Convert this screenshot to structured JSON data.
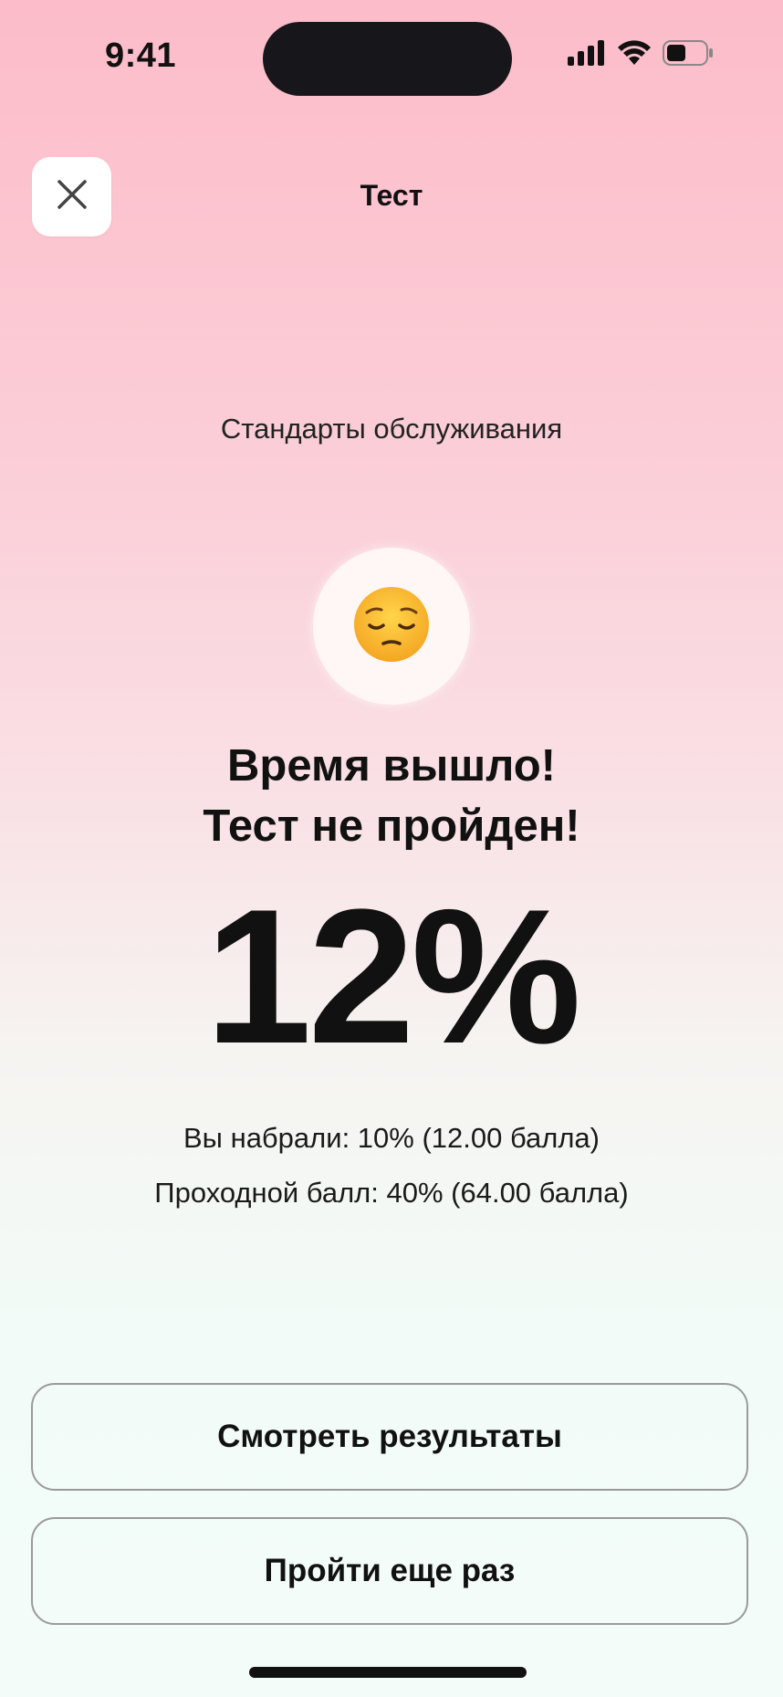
{
  "status_bar": {
    "time": "9:41",
    "icons": [
      "cellular-signal-icon",
      "wifi-icon",
      "battery-icon"
    ]
  },
  "header": {
    "title": "Тест",
    "close_icon": "close-icon"
  },
  "test": {
    "subject": "Стандарты обслуживания",
    "emoji": "😔",
    "result_line1": "Время вышло!",
    "result_line2": "Тест не пройден!",
    "percent_display": "12%",
    "score_text": "Вы набрали: 10% (12.00 балла)",
    "passing_text": "Проходной балл: 40% (64.00 балла)"
  },
  "actions": {
    "view_results_label": "Смотреть результаты",
    "retry_label": "Пройти еще раз"
  },
  "colors": {
    "background_top": "#fcbcc9",
    "background_bottom": "#f3fcf9",
    "button_border": "#9a9a9a",
    "text": "#111111"
  }
}
